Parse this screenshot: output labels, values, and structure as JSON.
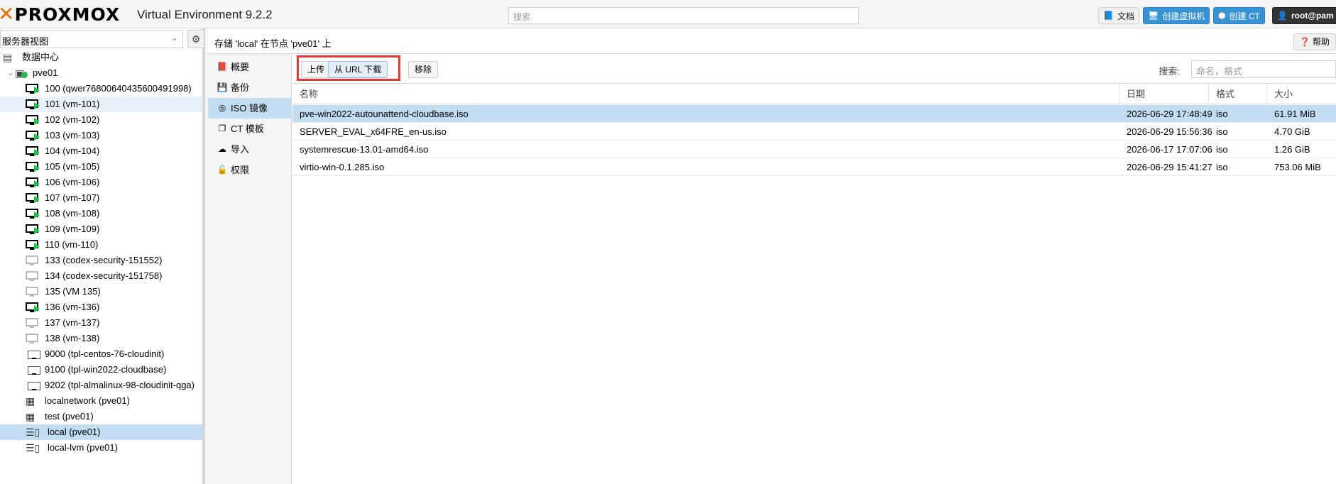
{
  "header": {
    "logo_text": "PROXMOX",
    "version": "Virtual Environment 9.2.2",
    "search_placeholder": "搜索",
    "docs_label": "文档",
    "create_vm_label": "创建虚拟机",
    "create_ct_label": "创建 CT",
    "user_label": "root@pam"
  },
  "sidebar": {
    "view_label": "服务器视图",
    "tree": [
      {
        "label": "数据中心",
        "kind": "datacenter"
      },
      {
        "label": "pve01",
        "kind": "node"
      },
      {
        "label": "100 (qwer76800640435600491998)",
        "kind": "vm-running"
      },
      {
        "label": "101 (vm-101)",
        "kind": "vm-running"
      },
      {
        "label": "102 (vm-102)",
        "kind": "vm-running"
      },
      {
        "label": "103 (vm-103)",
        "kind": "vm-running"
      },
      {
        "label": "104 (vm-104)",
        "kind": "vm-running"
      },
      {
        "label": "105 (vm-105)",
        "kind": "vm-running"
      },
      {
        "label": "106 (vm-106)",
        "kind": "vm-running"
      },
      {
        "label": "107 (vm-107)",
        "kind": "vm-running"
      },
      {
        "label": "108 (vm-108)",
        "kind": "vm-running"
      },
      {
        "label": "109 (vm-109)",
        "kind": "vm-running"
      },
      {
        "label": "110 (vm-110)",
        "kind": "vm-running"
      },
      {
        "label": "133 (codex-security-151552)",
        "kind": "vm-stopped"
      },
      {
        "label": "134 (codex-security-151758)",
        "kind": "vm-stopped"
      },
      {
        "label": "135 (VM 135)",
        "kind": "vm-stopped"
      },
      {
        "label": "136 (vm-136)",
        "kind": "vm-running"
      },
      {
        "label": "137 (vm-137)",
        "kind": "vm-stopped"
      },
      {
        "label": "138 (vm-138)",
        "kind": "vm-stopped"
      },
      {
        "label": "9000 (tpl-centos-76-cloudinit)",
        "kind": "template"
      },
      {
        "label": "9100 (tpl-win2022-cloudbase)",
        "kind": "template"
      },
      {
        "label": "9202 (tpl-almalinux-98-cloudinit-qga)",
        "kind": "template"
      },
      {
        "label": "localnetwork (pve01)",
        "kind": "network"
      },
      {
        "label": "test (pve01)",
        "kind": "network"
      },
      {
        "label": "local (pve01)",
        "kind": "storage"
      },
      {
        "label": "local-lvm (pve01)",
        "kind": "storage"
      }
    ]
  },
  "breadcrumb": "存储 'local' 在节点 'pve01' 上",
  "help_label": "帮助",
  "nav": [
    {
      "label": "概要",
      "icon": "book-icon"
    },
    {
      "label": "备份",
      "icon": "floppy-icon"
    },
    {
      "label": "ISO 镜像",
      "icon": "disc-icon"
    },
    {
      "label": "CT 模板",
      "icon": "copy-icon"
    },
    {
      "label": "导入",
      "icon": "cloud-upload-icon"
    },
    {
      "label": "权限",
      "icon": "unlock-icon"
    }
  ],
  "toolbar": {
    "upload_label": "上传",
    "download_url_label": "从 URL 下载",
    "remove_label": "移除",
    "search_label": "搜索:",
    "search_placeholder": "命名，格式"
  },
  "grid": {
    "columns": [
      "名称",
      "日期",
      "格式",
      "大小"
    ],
    "rows": [
      {
        "name": "pve-win2022-autounattend-cloudbase.iso",
        "date": "2026-06-29 17:48:49",
        "format": "iso",
        "size": "61.91 MiB"
      },
      {
        "name": "SERVER_EVAL_x64FRE_en-us.iso",
        "date": "2026-06-29 15:56:36",
        "format": "iso",
        "size": "4.70 GiB"
      },
      {
        "name": "systemrescue-13.01-amd64.iso",
        "date": "2026-06-17 17:07:06",
        "format": "iso",
        "size": "1.26 GiB"
      },
      {
        "name": "virtio-win-0.1.285.iso",
        "date": "2026-06-29 15:41:27",
        "format": "iso",
        "size": "753.06 MiB"
      }
    ]
  },
  "colors": {
    "accent": "#e57000",
    "selection": "#c2ddf2",
    "primary_button": "#3892d4",
    "highlight_box": "#e53935",
    "running": "#21bf4b"
  }
}
